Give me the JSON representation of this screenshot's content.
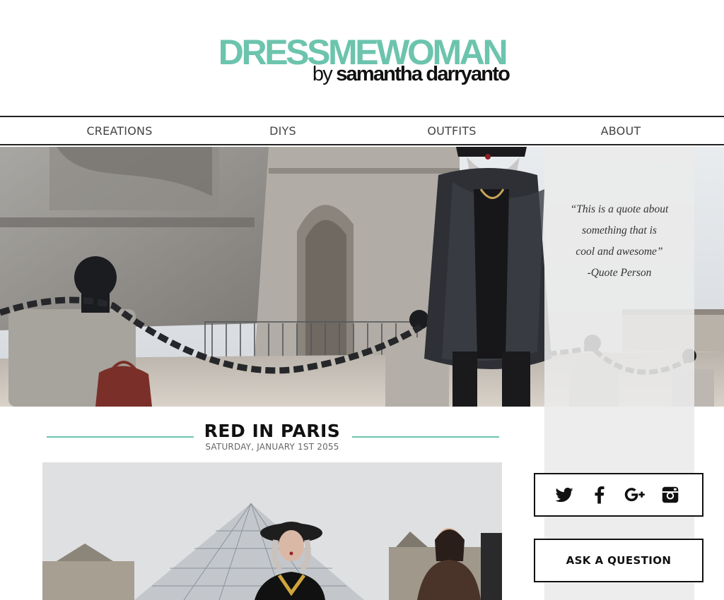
{
  "header": {
    "logo_main": "DRESSMEWOMAN",
    "logo_by": "by",
    "logo_name": "samantha darryanto"
  },
  "nav": {
    "items": [
      {
        "label": "CREATIONS"
      },
      {
        "label": "DIYS"
      },
      {
        "label": "OUTFITS"
      },
      {
        "label": "ABOUT"
      }
    ]
  },
  "sidebar": {
    "quote_lines": [
      "“This is a quote about",
      "something that is",
      "cool and awesome”",
      "-Quote Person"
    ],
    "social_icons": [
      "twitter-icon",
      "facebook-icon",
      "google-plus-icon",
      "instagram-icon"
    ],
    "ask_label": "ASK A QUESTION"
  },
  "post": {
    "title": "RED IN PARIS",
    "date": "SATURDAY,  JANUARY 1ST  2055"
  },
  "colors": {
    "accent": "#6cc4ad",
    "text": "#111111",
    "sidebar_bg": "#ebebeb"
  }
}
